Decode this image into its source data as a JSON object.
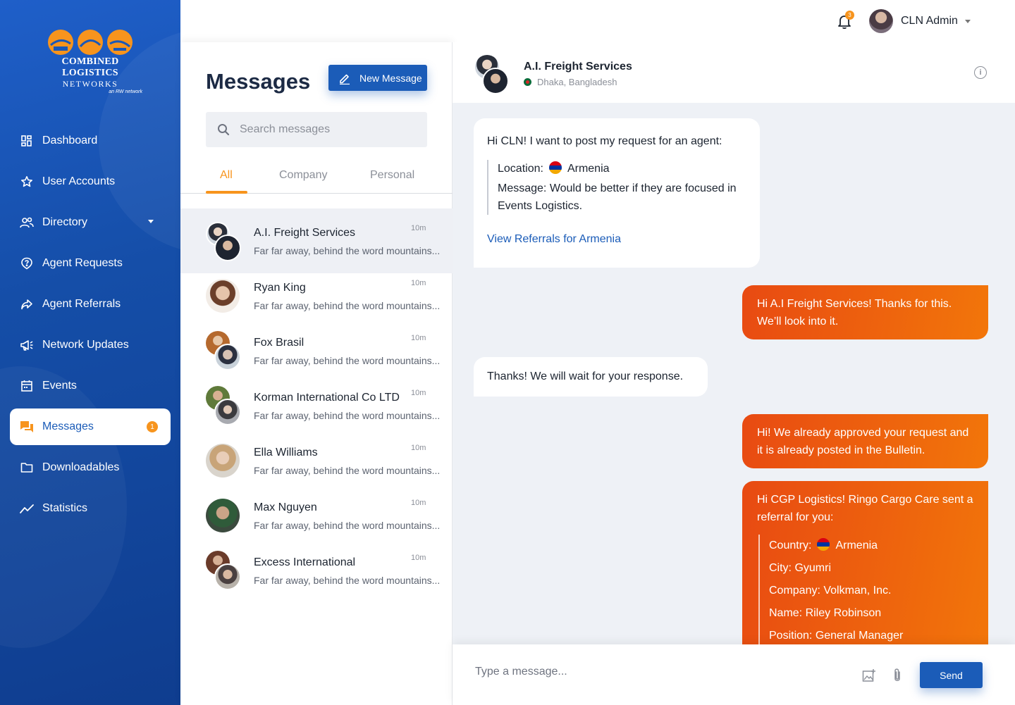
{
  "brand": {
    "line1": "COMBINED LOGISTICS",
    "line2": "NETWORKS",
    "line3": "an RW network",
    "accent": "#f7941d",
    "primary": "#1b5cb8"
  },
  "sidebar": {
    "items": [
      {
        "label": "Dashboard",
        "icon": "dashboard-icon"
      },
      {
        "label": "User Accounts",
        "icon": "star-icon"
      },
      {
        "label": "Directory",
        "icon": "people-icon"
      },
      {
        "label": "Agent Requests",
        "icon": "question-icon"
      },
      {
        "label": "Agent Referrals",
        "icon": "share-icon"
      },
      {
        "label": "Network Updates",
        "icon": "megaphone-icon"
      },
      {
        "label": "Events",
        "icon": "calendar-icon"
      },
      {
        "label": "Messages",
        "icon": "chat-icon",
        "badge": "1"
      },
      {
        "label": "Downloadables",
        "icon": "folder-icon"
      },
      {
        "label": "Statistics",
        "icon": "trend-icon"
      }
    ]
  },
  "topbar": {
    "notification_count": "3",
    "user_name": "CLN Admin"
  },
  "messages_panel": {
    "title": "Messages",
    "new_message_label": "New Message",
    "search_placeholder": "Search messages",
    "tabs": [
      "All",
      "Company",
      "Personal"
    ],
    "conversations": [
      {
        "name": "A.I. Freight Services",
        "snippet": "Far far away, behind the word mountains...",
        "time": "10m"
      },
      {
        "name": "Ryan King",
        "snippet": "Far far away, behind the word mountains...",
        "time": "10m"
      },
      {
        "name": "Fox Brasil",
        "snippet": "Far far away, behind the word mountains...",
        "time": "10m"
      },
      {
        "name": "Korman International Co LTD",
        "snippet": "Far far away, behind the word mountains...",
        "time": "10m"
      },
      {
        "name": "Ella Williams",
        "snippet": "Far far away, behind the word mountains...",
        "time": "10m"
      },
      {
        "name": "Max Nguyen",
        "snippet": "Far far away, behind the word mountains...",
        "time": "10m"
      },
      {
        "name": "Excess International",
        "snippet": "Far far away, behind the word mountains...",
        "time": "10m"
      }
    ]
  },
  "chat": {
    "contact_name": "A.I. Freight Services",
    "contact_location": "Dhaka, Bangladesh",
    "messages": {
      "m1_intro": "Hi CLN! I want to post my request for an agent:",
      "m1_location_label": "Location:",
      "m1_location_value": "Armenia",
      "m1_message": "Message: Would be better if they are focused in Events Logistics.",
      "m1_link": "View Referrals for Armenia",
      "m2": "Hi A.I Freight Services! Thanks for this. We’ll look into it.",
      "m3": "Thanks! We will wait for your response.",
      "m4": "Hi! We already approved your request and it is already posted in the Bulletin.",
      "m5_intro": "Hi CGP Logistics! Ringo Cargo Care sent a referral for you:",
      "m5_country_label": "Country:",
      "m5_country_value": "Armenia",
      "m5_city": "City: Gyumri",
      "m5_company": "Company: Volkman, Inc.",
      "m5_name": "Name: Riley Robinson",
      "m5_position": "Position: General Manager"
    },
    "composer_placeholder": "Type a message...",
    "send_label": "Send"
  }
}
